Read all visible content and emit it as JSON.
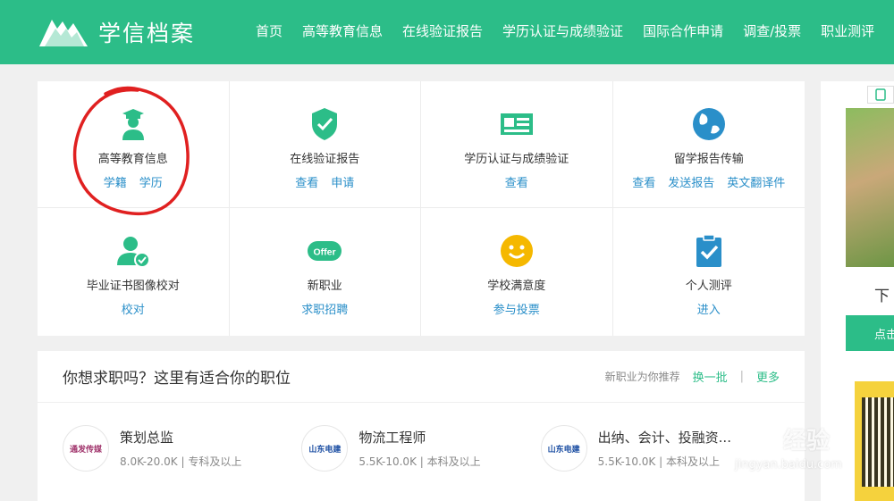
{
  "header": {
    "site_name": "学信档案",
    "nav": [
      "首页",
      "高等教育信息",
      "在线验证报告",
      "学历认证与成绩验证",
      "国际合作申请",
      "调查/投票",
      "职业测评"
    ]
  },
  "services": [
    {
      "title": "高等教育信息",
      "links": [
        "学籍",
        "学历"
      ],
      "icon": "graduate-icon"
    },
    {
      "title": "在线验证报告",
      "links": [
        "查看",
        "申请"
      ],
      "icon": "shield-check-icon"
    },
    {
      "title": "学历认证与成绩验证",
      "links": [
        "查看"
      ],
      "icon": "id-card-icon"
    },
    {
      "title": "留学报告传输",
      "links": [
        "查看",
        "发送报告",
        "英文翻译件"
      ],
      "icon": "globe-icon"
    },
    {
      "title": "毕业证书图像校对",
      "links": [
        "校对"
      ],
      "icon": "user-check-icon"
    },
    {
      "title": "新职业",
      "links": [
        "求职招聘"
      ],
      "icon": "offer-icon",
      "badge": "Offer"
    },
    {
      "title": "学校满意度",
      "links": [
        "参与投票"
      ],
      "icon": "smile-icon"
    },
    {
      "title": "个人测评",
      "links": [
        "进入"
      ],
      "icon": "clipboard-check-icon"
    }
  ],
  "jobs": {
    "title": "你想求职吗？这里有适合你的职位",
    "recommend_text": "新职业为你推荐",
    "refresh_label": "换一批",
    "more_label": "更多",
    "items": [
      {
        "name": "策划总监",
        "salary": "8.0K-20.0K",
        "education": "专科及以上",
        "logo_text": "通发传媒"
      },
      {
        "name": "物流工程师",
        "salary": "5.5K-10.0K",
        "education": "本科及以上",
        "logo_text": "山东电建"
      },
      {
        "name": "出纳、会计、投融资...",
        "salary": "5.5K-10.0K",
        "education": "本科及以上",
        "logo_text": "山东电建"
      }
    ]
  },
  "side": {
    "text": "下",
    "button_label": "点击"
  },
  "watermark": {
    "text": "经验",
    "url": "jingyan.baidu.com"
  },
  "colors": {
    "brand": "#2cbd88",
    "link": "#2a8fc9",
    "annotation": "#e02020"
  }
}
